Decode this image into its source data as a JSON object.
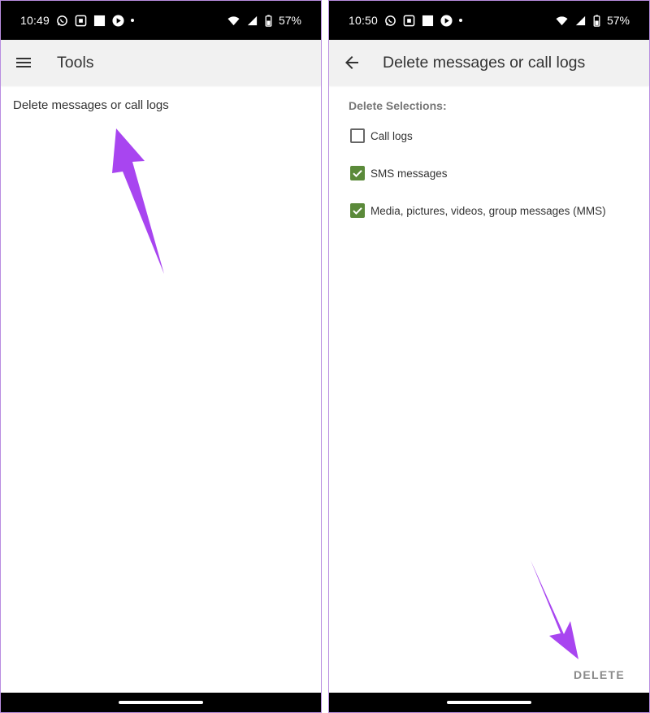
{
  "colors": {
    "accent_arrow": "#a845f0",
    "checkbox_checked": "#5b8a3a",
    "app_bar_bg": "#f1f1f1",
    "frame_border": "#b98de0"
  },
  "left_screen": {
    "status": {
      "time": "10:49",
      "battery": "57%"
    },
    "app_bar": {
      "title": "Tools",
      "nav_icon": "menu-icon"
    },
    "menu_items": [
      {
        "label": "Delete messages or call logs"
      }
    ]
  },
  "right_screen": {
    "status": {
      "time": "10:50",
      "battery": "57%"
    },
    "app_bar": {
      "title": "Delete messages or call logs",
      "nav_icon": "back-arrow-icon"
    },
    "section_header": "Delete Selections:",
    "options": [
      {
        "label": "Call logs",
        "checked": false
      },
      {
        "label": "SMS messages",
        "checked": true
      },
      {
        "label": "Media, pictures, videos, group messages (MMS)",
        "checked": true
      }
    ],
    "delete_label": "DELETE"
  }
}
